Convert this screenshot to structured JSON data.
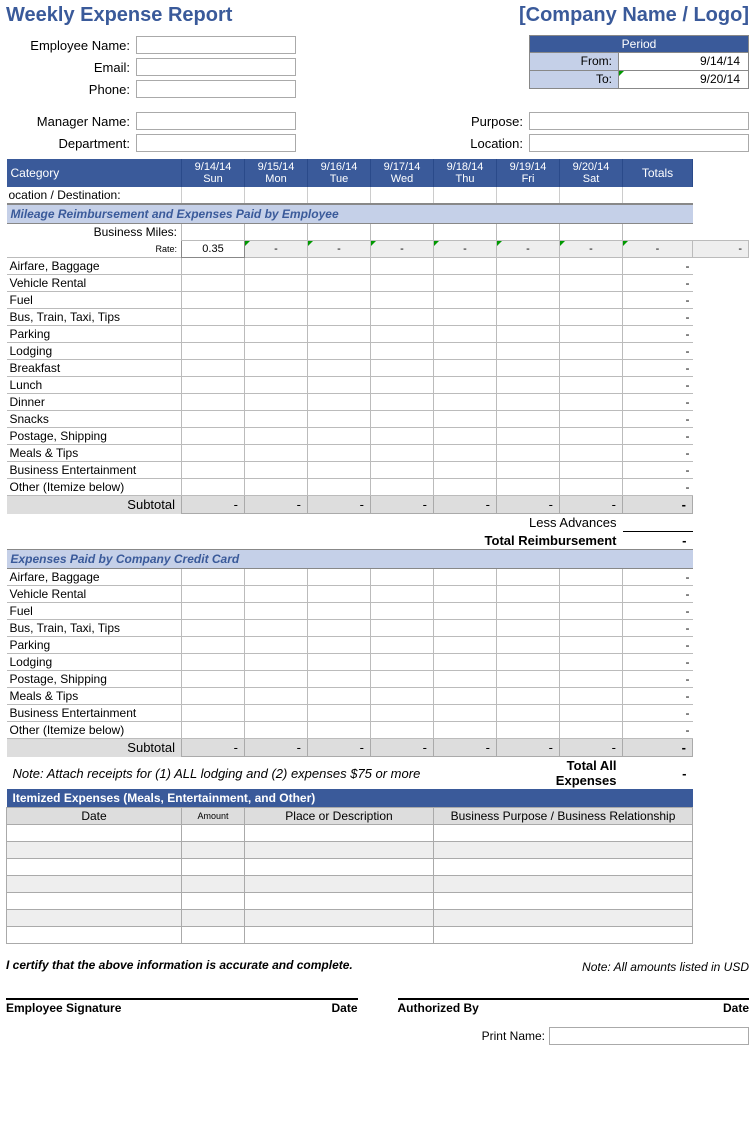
{
  "title": "Weekly Expense Report",
  "company": "[Company Name / Logo]",
  "fields": {
    "emp_name": "Employee Name:",
    "email": "Email:",
    "phone": "Phone:",
    "mgr_name": "Manager Name:",
    "dept": "Department:",
    "purpose": "Purpose:",
    "location": "Location:"
  },
  "period": {
    "hdr": "Period",
    "from_lbl": "From:",
    "from": "9/14/14",
    "to_lbl": "To:",
    "to": "9/20/14"
  },
  "headers": {
    "category": "Category",
    "totals": "Totals",
    "location_dest": "ocation / Destination:"
  },
  "days": [
    {
      "date": "9/14/14",
      "day": "Sun"
    },
    {
      "date": "9/15/14",
      "day": "Mon"
    },
    {
      "date": "9/16/14",
      "day": "Tue"
    },
    {
      "date": "9/17/14",
      "day": "Wed"
    },
    {
      "date": "9/18/14",
      "day": "Thu"
    },
    {
      "date": "9/19/14",
      "day": "Fri"
    },
    {
      "date": "9/20/14",
      "day": "Sat"
    }
  ],
  "section1": {
    "title": "Mileage Reimbursement and Expenses Paid by Employee",
    "biz_miles": "Business Miles:",
    "rate_lbl": "Rate:",
    "rate": "0.35",
    "rows": [
      "Airfare, Baggage",
      "Vehicle Rental",
      "Fuel",
      "Bus, Train, Taxi, Tips",
      "Parking",
      "Lodging",
      "Breakfast",
      "Lunch",
      "Dinner",
      "Snacks",
      "Postage, Shipping",
      "Meals & Tips",
      "Business Entertainment",
      "Other (Itemize below)"
    ],
    "subtotal": "Subtotal",
    "less": "Less Advances",
    "total_reimb": "Total Reimbursement"
  },
  "section2": {
    "title": "Expenses Paid by Company Credit Card",
    "rows": [
      "Airfare, Baggage",
      "Vehicle Rental",
      "Fuel",
      "Bus, Train, Taxi, Tips",
      "Parking",
      "Lodging",
      "Postage, Shipping",
      "Meals & Tips",
      "Business Entertainment",
      "Other (Itemize below)"
    ],
    "subtotal": "Subtotal",
    "note": "Note:  Attach receipts for (1) ALL lodging and (2) expenses $75 or more",
    "total_all": "Total All Expenses"
  },
  "itemized": {
    "title": "Itemized Expenses (Meals, Entertainment, and Other)",
    "cols": {
      "date": "Date",
      "amount": "Amount",
      "place": "Place or Description",
      "purpose": "Business Purpose / Business Relationship"
    },
    "row_count": 7
  },
  "cert": "I certify that the above information is accurate and complete.",
  "note_usd": "Note: All amounts listed in USD",
  "sig": {
    "emp": "Employee Signature",
    "date": "Date",
    "auth": "Authorized By",
    "print": "Print Name:"
  },
  "dash": "-"
}
